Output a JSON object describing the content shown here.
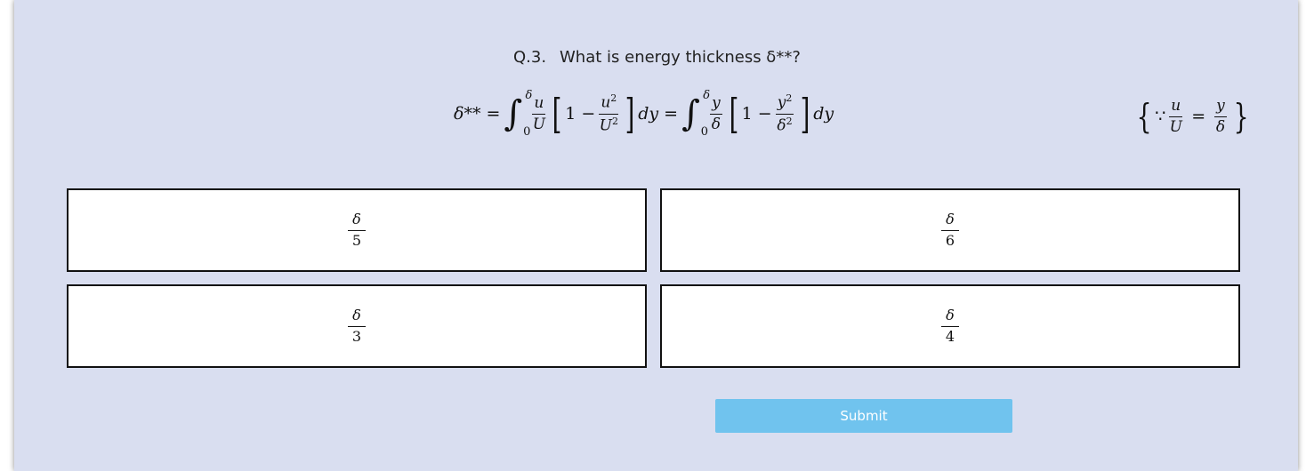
{
  "question": {
    "number": "Q.3.",
    "text": "What is energy thickness δ**?"
  },
  "equation": {
    "lhs": "δ**",
    "equals": "=",
    "integral_upper": "δ",
    "integral_lower": "0",
    "frac1_num": "u",
    "frac1_den": "U",
    "bracket_one": "1 −",
    "frac2_num": "u",
    "frac2_num_exp": "2",
    "frac2_den": "U",
    "frac2_den_exp": "2",
    "dy": "dy",
    "frac3_num": "y",
    "frac3_den": "δ",
    "frac4_num": "y",
    "frac4_num_exp": "2",
    "frac4_den": "δ",
    "frac4_den_exp": "2"
  },
  "note": {
    "because": "∵",
    "lhs_num": "u",
    "lhs_den": "U",
    "equals": "=",
    "rhs_num": "y",
    "rhs_den": "δ"
  },
  "options": [
    {
      "num": "δ",
      "den": "5"
    },
    {
      "num": "δ",
      "den": "6"
    },
    {
      "num": "δ",
      "den": "3"
    },
    {
      "num": "δ",
      "den": "4"
    }
  ],
  "submit_label": "Submit",
  "colors": {
    "panel_bg": "#d9def0",
    "submit_bg": "#70c3ee",
    "option_border": "#111111"
  }
}
